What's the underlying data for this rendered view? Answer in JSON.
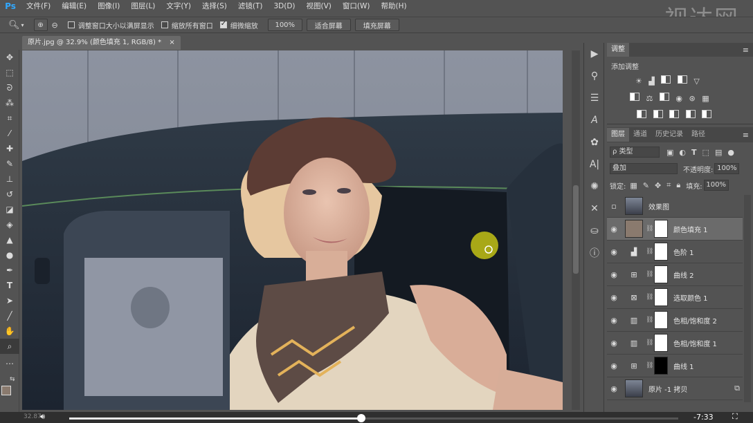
{
  "app": {
    "logo": "Ps",
    "watermark": "视达网"
  },
  "menu": [
    "文件(F)",
    "编辑(E)",
    "图像(I)",
    "图层(L)",
    "文字(Y)",
    "选择(S)",
    "滤镜(T)",
    "3D(D)",
    "视图(V)",
    "窗口(W)",
    "帮助(H)"
  ],
  "options": {
    "resize_windows": "调整窗口大小以满屏显示",
    "zoom_all": "缩放所有窗口",
    "scrubby": "细微缩放",
    "zoom_value": "100%",
    "fit_screen": "适合屏幕",
    "fill_screen": "填充屏幕"
  },
  "document": {
    "tab_title": "原片.jpg @ 32.9% (颜色填充 1, RGB/8) *",
    "zoom_status": "32.87"
  },
  "adjust_panel": {
    "tab": "调整",
    "subtitle": "添加调整"
  },
  "layers_panel": {
    "tabs": [
      "图层",
      "通道",
      "历史记录",
      "路径"
    ],
    "filter_label": "ρ 类型",
    "blend_mode": "叠加",
    "opacity_label": "不透明度:",
    "opacity_value": "100%",
    "lock_label": "锁定:",
    "fill_label": "填充:",
    "fill_value": "100%",
    "layers": [
      {
        "name": "效果图",
        "visible": false
      },
      {
        "name": "颜色填充 1",
        "visible": true,
        "selected": true
      },
      {
        "name": "色阶 1",
        "visible": true
      },
      {
        "name": "曲线 2",
        "visible": true
      },
      {
        "name": "选取颜色 1",
        "visible": true
      },
      {
        "name": "色相/饱和度 2",
        "visible": true
      },
      {
        "name": "色相/饱和度 1",
        "visible": true
      },
      {
        "name": "曲线 1",
        "visible": true
      },
      {
        "name": "原片 -1 拷贝",
        "visible": true
      }
    ]
  },
  "video": {
    "time": "-7:33",
    "progress": 0.48
  },
  "colors": {
    "fill_swatch": "#8a7a6e",
    "accent": "#31a8ff"
  }
}
